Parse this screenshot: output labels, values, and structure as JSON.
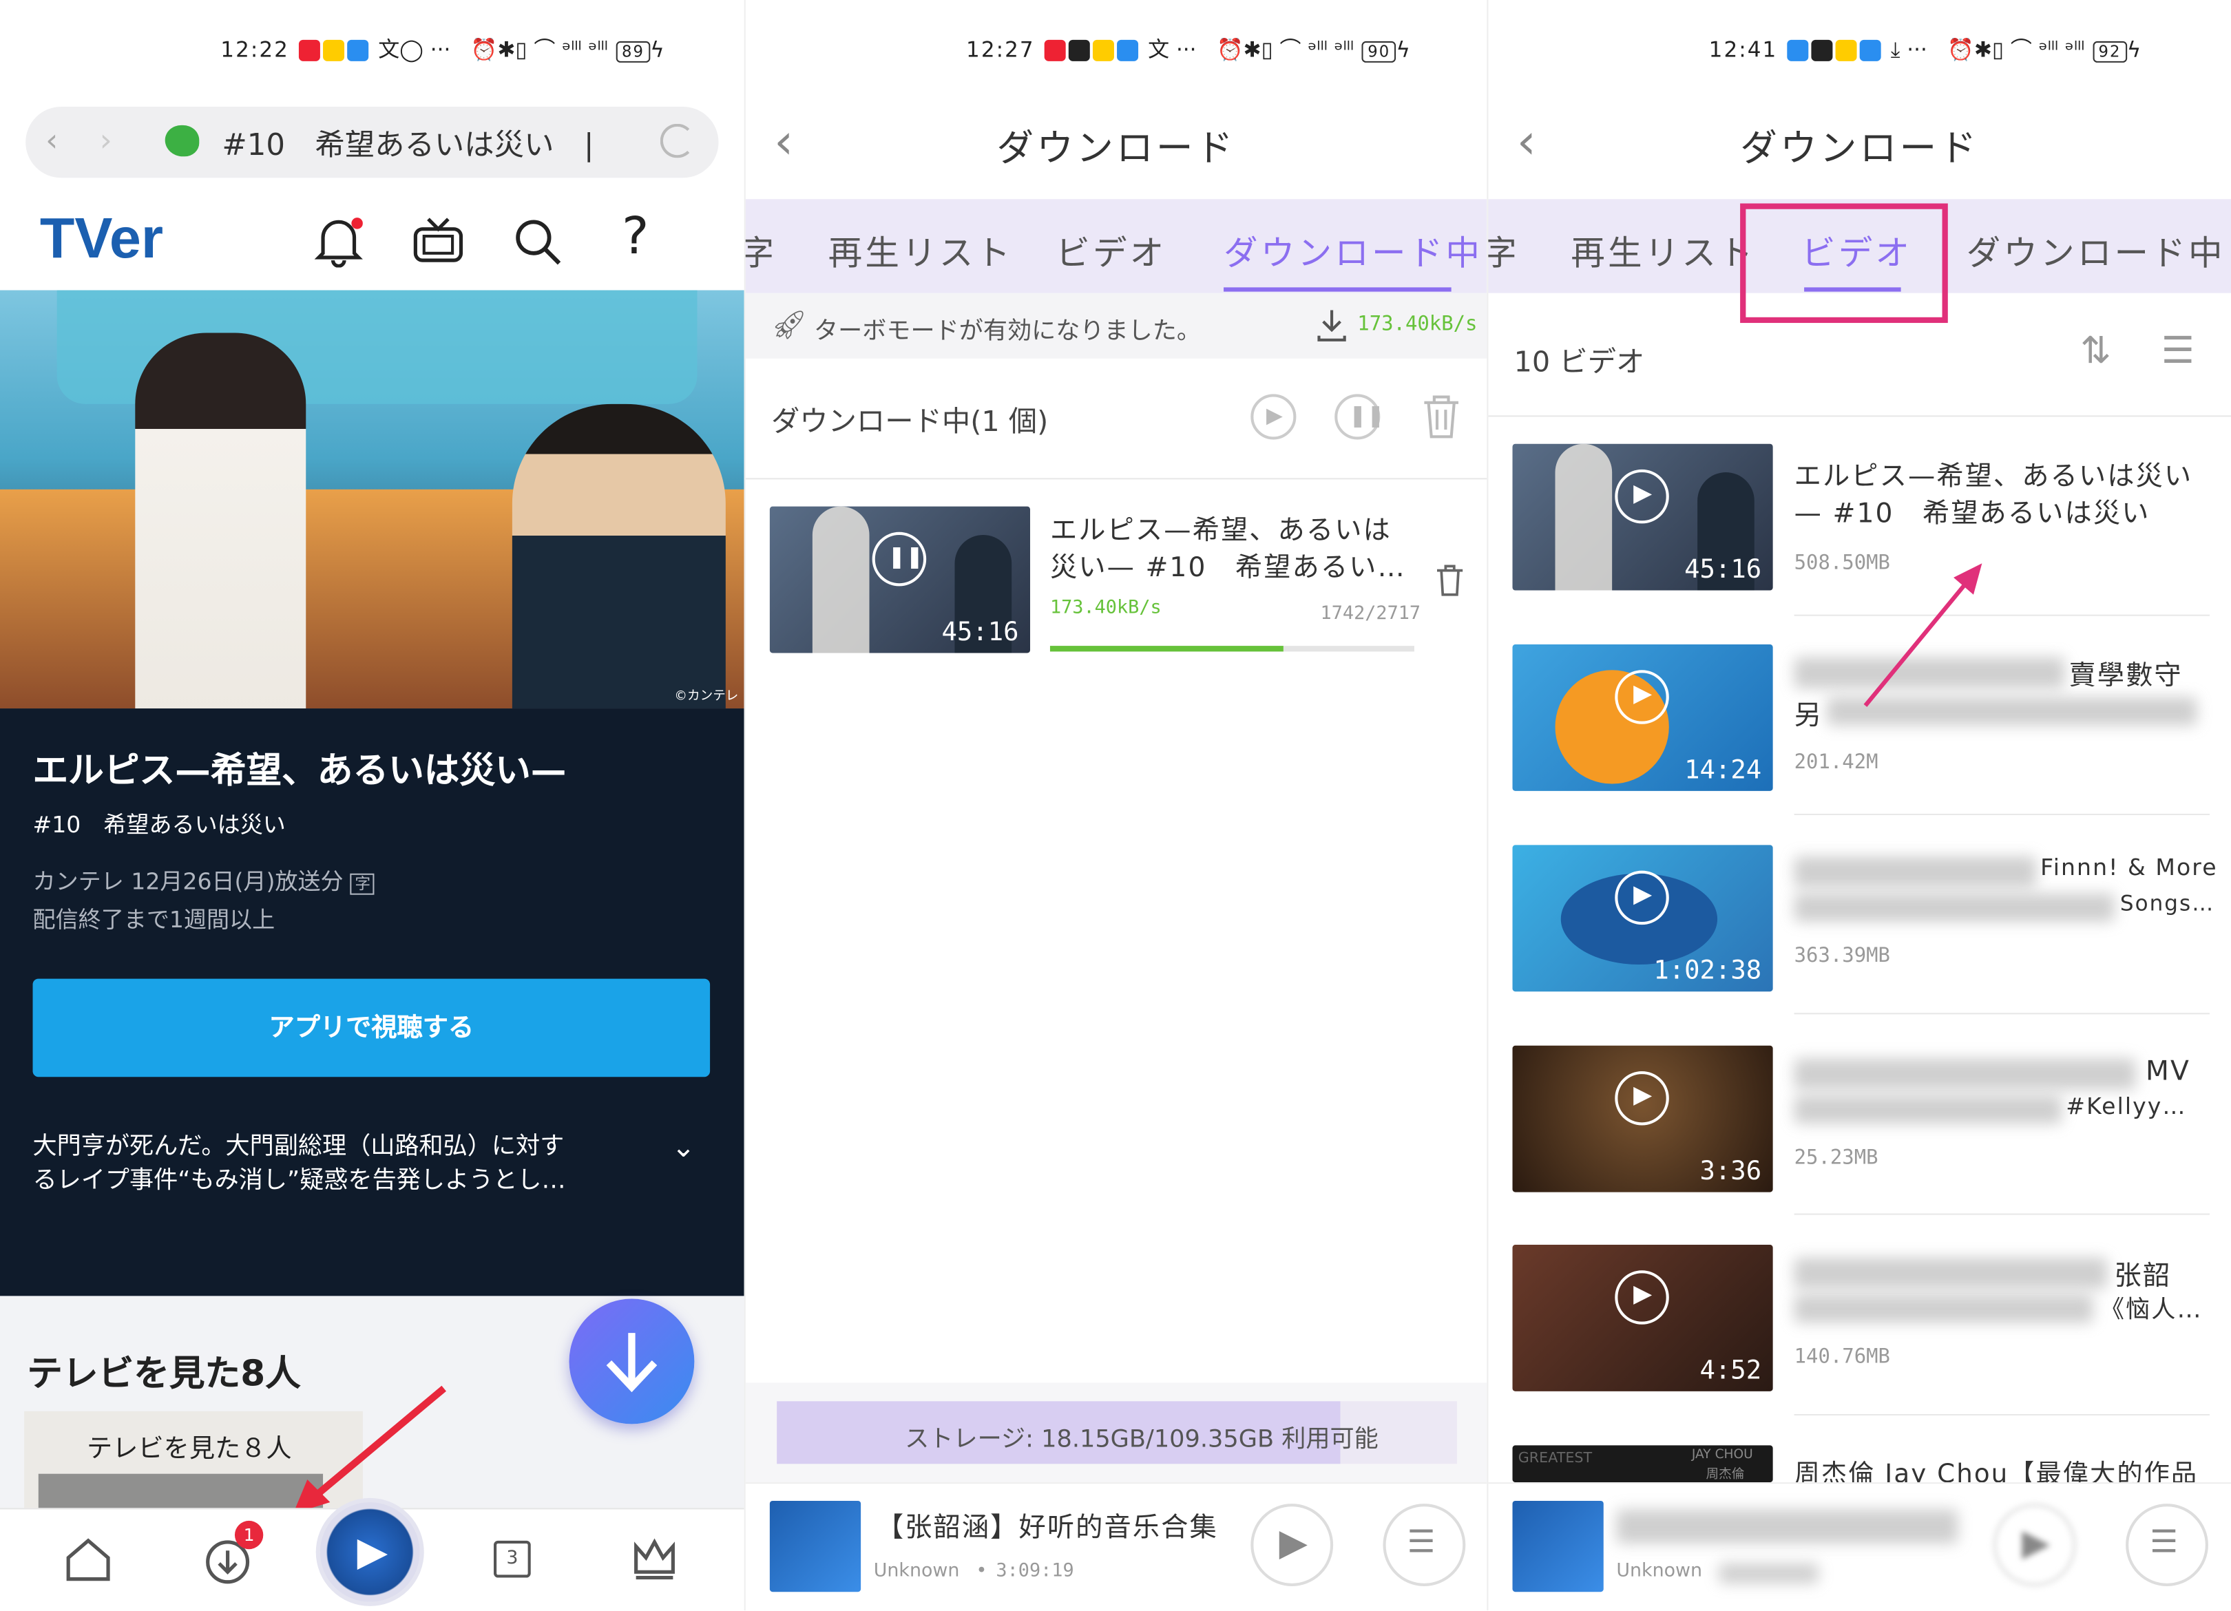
{
  "p1": {
    "status": {
      "time": "12:22",
      "battery": "89"
    },
    "address": {
      "text": "#10　希望あるいは災い　|"
    },
    "logo": "TVer",
    "hero_credit": "©カンテレ",
    "show": {
      "title": "エルピス—希望、あるいは災い—",
      "episode": "#10　希望あるいは災い",
      "broadcast": "カンテレ 12月26日(月)放送分",
      "expiry": "配信終了まで1週間以上",
      "watch_button": "アプリで視聴する",
      "synopsis_l1": "大門亨が死んだ。大門副総理（山路和弘）に対す",
      "synopsis_l2": "るレイプ事件“もみ消し”疑惑を告発しようとし…"
    },
    "section_title": "テレビを見た8人",
    "card_text": "テレビを見た８人",
    "download_badge": "1",
    "nav_tv_num": "3",
    "colors": {
      "accent_blue": "#1aa3e8",
      "arrow_red": "#e8283c"
    }
  },
  "p2": {
    "status": {
      "time": "12:27",
      "battery": "90"
    },
    "title": "ダウンロード",
    "tabs": [
      "字",
      "再生リスト",
      "ビデオ",
      "ダウンロード中"
    ],
    "turbo": {
      "text": "ターボモードが有効になりました。",
      "speed": "173.40kB/s"
    },
    "downloading": {
      "heading": "ダウンロード中(1 個)"
    },
    "item": {
      "title_l1": "エルピス—希望、あるいは",
      "title_l2": "災い— #10　希望あるい…",
      "speed": "173.40kB/s",
      "progress_text": "1742/2717",
      "progress": 0.64,
      "duration": "45:16"
    },
    "storage": {
      "text": "ストレージ: 18.15GB/109.35GB 利用可能"
    },
    "player": {
      "title": "【张韶涵】好听的音乐合集",
      "artist": "Unknown",
      "length": "3:09:19"
    },
    "colors": {
      "accent_purple": "#8b6ef0",
      "progress_green": "#66c23a"
    }
  },
  "p3": {
    "status": {
      "time": "12:41",
      "battery": "92"
    },
    "title": "ダウンロード",
    "tabs": [
      "字",
      "再生リスト",
      "ビデオ",
      "ダウンロード中"
    ],
    "count": "10 ビデオ",
    "items": [
      {
        "title_l1": "エルピス—希望、あるいは災い",
        "title_l2": "— #10　希望あるいは災い",
        "size": "508.50MB",
        "duration": "45:16"
      },
      {
        "title_l1": "賣學數守",
        "title_l2": "另",
        "size": "201.42M",
        "duration": "14:24"
      },
      {
        "title_l1": "Finnn! & More",
        "title_l2": "Songs…",
        "size": "363.39MB",
        "duration": "1:02:38"
      },
      {
        "title_l1": "MV",
        "title_l2": "#Kellyy…",
        "size": "25.23MB",
        "duration": "3:36"
      },
      {
        "title_l1": "张韶",
        "title_l2": "《恼人…",
        "size": "140.76MB",
        "duration": "4:52"
      },
      {
        "title_l1": "周杰倫 Jay Chou【最偉大的作品",
        "title_l2": "",
        "size": "",
        "duration": ""
      }
    ],
    "thumb6_labels": [
      "GREATEST",
      "JAY CHOU",
      "周杰倫"
    ],
    "player": {
      "artist": "Unknown"
    },
    "colors": {
      "highlight_pink": "#e0307a"
    }
  }
}
